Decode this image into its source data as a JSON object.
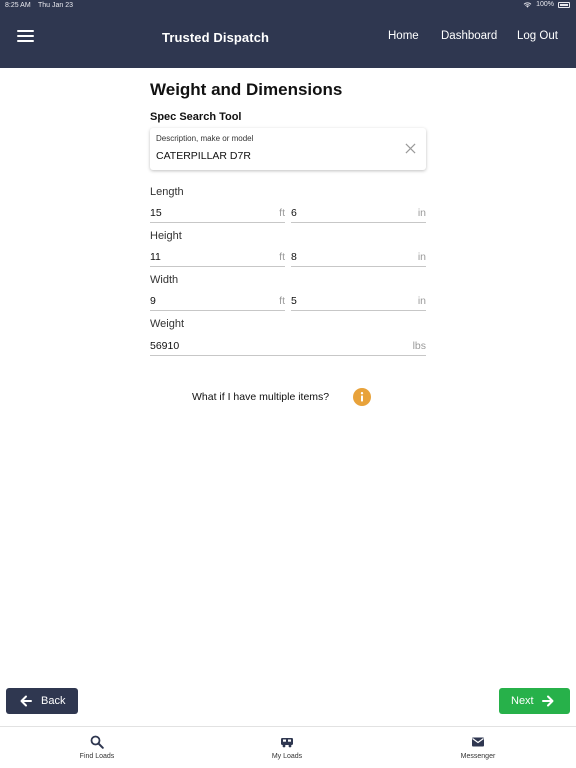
{
  "status_bar": {
    "time": "8:25 AM",
    "date": "Thu Jan 23",
    "battery": "100%"
  },
  "header": {
    "title": "Trusted Dispatch",
    "nav": {
      "home": "Home",
      "dashboard": "Dashboard",
      "logout": "Log Out"
    },
    "menu_icon": "hamburger-icon"
  },
  "page": {
    "title": "Weight and Dimensions",
    "spec_search": {
      "section_title": "Spec Search Tool",
      "label": "Description, make or model",
      "value": "CATERPILLAR D7R",
      "clear_icon": "close-icon"
    },
    "fields": {
      "length": {
        "label": "Length",
        "ft": "15",
        "ft_unit": "ft",
        "in": "6",
        "in_unit": "in"
      },
      "height": {
        "label": "Height",
        "ft": "11",
        "ft_unit": "ft",
        "in": "8",
        "in_unit": "in"
      },
      "width": {
        "label": "Width",
        "ft": "9",
        "ft_unit": "ft",
        "in": "5",
        "in_unit": "in"
      },
      "weight": {
        "label": "Weight",
        "value": "56910",
        "unit": "lbs"
      }
    },
    "multiple_items": {
      "text": "What if I have multiple items?",
      "icon": "info-icon",
      "icon_color": "#e8a23a"
    }
  },
  "buttons": {
    "back": "Back",
    "next": "Next"
  },
  "tabbar": {
    "find_loads": "Find Loads",
    "my_loads": "My Loads",
    "messenger": "Messenger"
  },
  "colors": {
    "header_bg": "#2f3750",
    "back_bg": "#2f3750",
    "next_bg": "#27b14a",
    "accent": "#e8a23a"
  }
}
